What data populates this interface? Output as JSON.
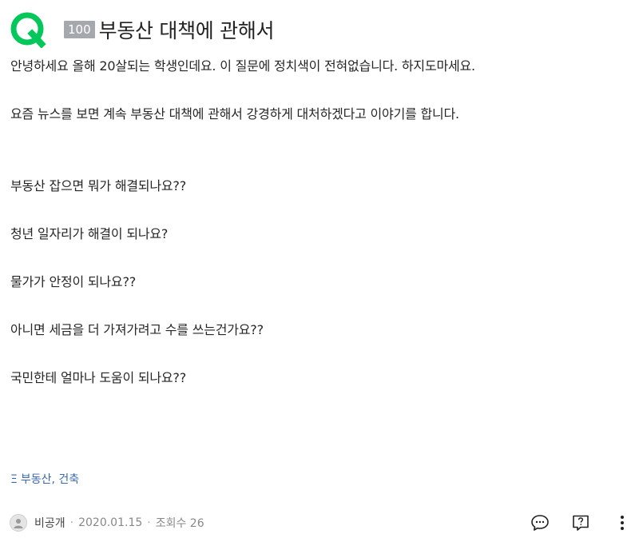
{
  "question": {
    "points": "100",
    "title": "부동산 대책에 관해서"
  },
  "body_lines": [
    "안녕하세요 올해 20살되는 학생인데요. 이 질문에 정치색이 전혀없습니다. 하지도마세요.",
    "요즘 뉴스를 보면 계속 부동산 대책에 관해서 강경하게 대처하겠다고 이야기를 합니다.",
    "부동산 잡으면 뭐가 해결되나요??",
    "청년 일자리가 해결이 되나요?",
    "물가가 안정이 되나요??",
    "아니면 세금을 더 가져가려고 수를 쓰는건가요??",
    "국민한테 얼마나 도움이 되나요??"
  ],
  "tags": {
    "icon": "Ξ",
    "text": "부동산, 건축"
  },
  "meta": {
    "author": "비공개",
    "date": "2020.01.15",
    "views": "조회수 26"
  },
  "icons": {
    "logo": "q-logo-icon",
    "avatar": "user-avatar-icon",
    "comment": "comment-icon",
    "help": "question-mark-icon",
    "more": "more-vertical-icon"
  },
  "colors": {
    "brand": "#03c75a",
    "tag": "#3a68b0",
    "badge": "#a5a9ad"
  }
}
